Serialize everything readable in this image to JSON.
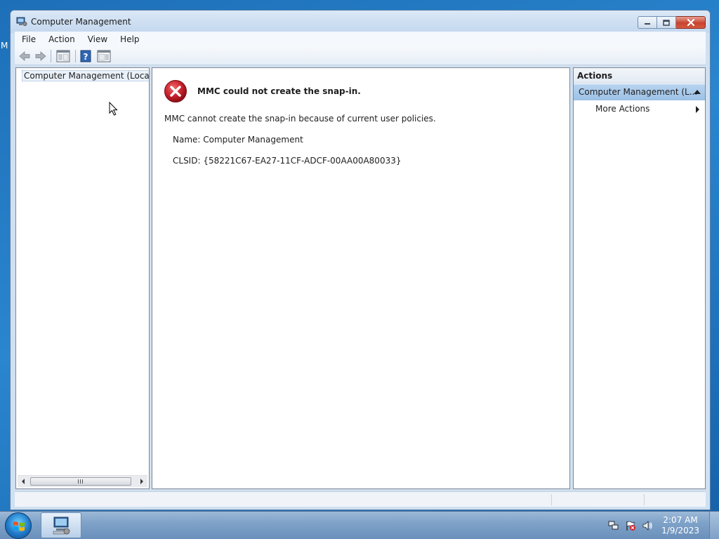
{
  "desktop": {
    "edge_label": "M"
  },
  "window": {
    "title": "Computer Management",
    "menu": [
      "File",
      "Action",
      "View",
      "Help"
    ]
  },
  "tree": {
    "root_label": "Computer Management (Local"
  },
  "content": {
    "error_title": "MMC could not create the snap-in.",
    "error_message": "MMC cannot create the snap-in because of current user policies.",
    "name_line": "Name: Computer Management",
    "clsid_line": "CLSID: {58221C67-EA27-11CF-ADCF-00AA00A80033}"
  },
  "actions": {
    "header": "Actions",
    "section_title": "Computer Management (L...",
    "more_actions": "More Actions"
  },
  "taskbar": {
    "time": "2:07 AM",
    "date": "1/9/2023"
  },
  "colors": {
    "error_red": "#c8202b",
    "actions_highlight": "#a9cbed",
    "desktop_blue": "#1d6fb8"
  },
  "icons": {
    "title": "computer-management-icon",
    "back": "back-arrow-icon",
    "forward": "forward-arrow-icon",
    "show_hide_tree": "show-hide-console-tree-icon",
    "help": "help-icon",
    "show_hide_action": "show-hide-action-pane-icon",
    "error": "error-icon",
    "tray": [
      "network-icon",
      "action-center-flag-icon",
      "speaker-icon"
    ]
  }
}
